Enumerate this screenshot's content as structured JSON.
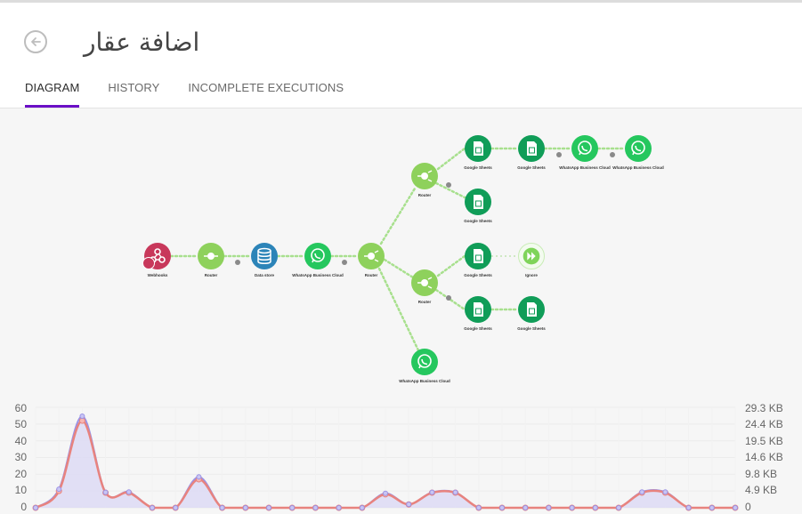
{
  "header": {
    "title": "اضافة عقار",
    "tabs": [
      {
        "label": "DIAGRAM",
        "active": true
      },
      {
        "label": "HISTORY",
        "active": false
      },
      {
        "label": "INCOMPLETE EXECUTIONS",
        "active": false
      }
    ]
  },
  "colors": {
    "accent": "#6b0fc6",
    "webhook": "#c8385b",
    "router": "#8ed15c",
    "datastore": "#2c84b8",
    "whatsapp": "#25c75e",
    "sheets": "#109d58",
    "ignore": "#7fd45a",
    "ops_line": "#e8837e",
    "ops_fill": "#dcd9f5",
    "data_line": "#9a93e6"
  },
  "diagram": {
    "nodes": [
      {
        "id": "webhooks",
        "label": "Webhooks",
        "icon": "webhook-icon"
      },
      {
        "id": "router1",
        "label": "Router",
        "icon": "router-icon"
      },
      {
        "id": "datastore",
        "label": "Data store",
        "icon": "database-icon"
      },
      {
        "id": "wa1",
        "label": "WhatsApp Business Cloud",
        "icon": "whatsapp-icon"
      },
      {
        "id": "router2",
        "label": "Router",
        "icon": "router-icon"
      },
      {
        "id": "router3",
        "label": "Router",
        "icon": "router-icon"
      },
      {
        "id": "gs1",
        "label": "Google Sheets",
        "icon": "google-sheets-icon"
      },
      {
        "id": "gs2",
        "label": "Google Sheets",
        "icon": "google-sheets-icon"
      },
      {
        "id": "wa2",
        "label": "WhatsApp Business Cloud",
        "icon": "whatsapp-icon"
      },
      {
        "id": "wa3",
        "label": "WhatsApp Business Cloud",
        "icon": "whatsapp-icon"
      },
      {
        "id": "gs3",
        "label": "Google Sheets",
        "icon": "google-sheets-icon"
      },
      {
        "id": "router4",
        "label": "Router",
        "icon": "router-icon"
      },
      {
        "id": "gs4",
        "label": "Google Sheets",
        "icon": "google-sheets-icon"
      },
      {
        "id": "ignore",
        "label": "Ignore",
        "icon": "fast-forward-icon"
      },
      {
        "id": "gs5",
        "label": "Google Sheets",
        "icon": "google-sheets-icon"
      },
      {
        "id": "gs6",
        "label": "Google Sheets",
        "icon": "google-sheets-icon"
      },
      {
        "id": "wa4",
        "label": "WhatsApp Business Cloud",
        "icon": "whatsapp-icon"
      }
    ]
  },
  "chart_data": {
    "type": "area",
    "y_left_ticks": [
      "60",
      "50",
      "40",
      "30",
      "20",
      "10",
      "0"
    ],
    "y_right_ticks": [
      "29.3 KB",
      "24.4 KB",
      "19.5 KB",
      "14.6 KB",
      "9.8 KB",
      "4.9 KB",
      "0"
    ],
    "ylim_left": [
      0,
      60
    ],
    "ylim_right_kb": [
      0,
      29.3
    ],
    "grid": true,
    "series": [
      {
        "axis": "left",
        "values": [
          0,
          10,
          52,
          9,
          9,
          0,
          0,
          17,
          0,
          0,
          0,
          0,
          0,
          0,
          0,
          8,
          2,
          9,
          9,
          0,
          0,
          0,
          0,
          0,
          0,
          0,
          9,
          9,
          0,
          0,
          0
        ]
      },
      {
        "axis": "right",
        "values": [
          0,
          5.4,
          26.7,
          4.5,
          4.6,
          0,
          0,
          9.0,
          0,
          0,
          0,
          0,
          0,
          0,
          0,
          4.2,
          1.0,
          4.5,
          4.5,
          0,
          0,
          0,
          0,
          0,
          0,
          0,
          4.6,
          4.6,
          0,
          0,
          0
        ]
      }
    ]
  }
}
